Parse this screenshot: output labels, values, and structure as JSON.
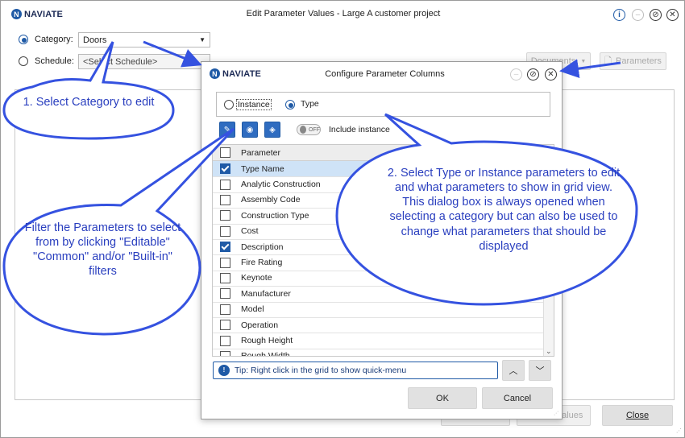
{
  "main": {
    "title": "Edit Parameter Values - Large A customer project",
    "logo": "NAVIATE",
    "category_label": "Category:",
    "category_value": "Doors",
    "schedule_label": "Schedule:",
    "schedule_value": "<Select Schedule>",
    "documents_label": "Documents",
    "parameters_label": "Parameters",
    "values_label": "Values",
    "close_label": "Close",
    "info_icon": "info-icon",
    "minimize_icon": "minimize-icon",
    "restore_icon": "restore-icon",
    "close_icon": "close-icon"
  },
  "dialog": {
    "logo": "NAVIATE",
    "title": "Configure Parameter Columns",
    "instance_label": "Instance",
    "type_label": "Type",
    "include_instance_label": "Include instance",
    "toggle_label": "OFF",
    "grid_header": "Parameter",
    "rows": [
      {
        "label": "Type Name",
        "checked": true,
        "selected": true
      },
      {
        "label": "Analytic Construction",
        "checked": false
      },
      {
        "label": "Assembly Code",
        "checked": false
      },
      {
        "label": "Construction Type",
        "checked": false
      },
      {
        "label": "Cost",
        "checked": false
      },
      {
        "label": "Description",
        "checked": true
      },
      {
        "label": "Fire Rating",
        "checked": false
      },
      {
        "label": "Keynote",
        "checked": false
      },
      {
        "label": "Manufacturer",
        "checked": false
      },
      {
        "label": "Model",
        "checked": false
      },
      {
        "label": "Operation",
        "checked": false
      },
      {
        "label": "Rough Height",
        "checked": false
      },
      {
        "label": "Rough Width",
        "checked": false
      }
    ],
    "tip": "Tip: Right click in the grid to show quick-menu",
    "ok_label": "OK",
    "cancel_label": "Cancel"
  },
  "callouts": {
    "select_category": "1. Select Category to edit",
    "filter": "Filter the Parameters to select from by clicking \"Editable\" \"Common\" and/or \"Built-in\" filters",
    "type_instance": "2. Select Type or Instance parameters to edit and what parameters to show in grid view.\nThis dialog box is always opened when selecting a category but can also be used to change what parameters that should be displayed"
  },
  "colors": {
    "accent": "#1f5aa6",
    "callout_stroke": "#3552e0",
    "callout_text": "#2a3fbf"
  }
}
